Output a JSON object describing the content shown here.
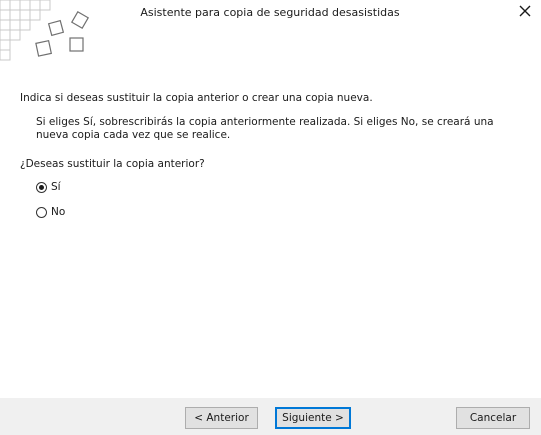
{
  "window": {
    "title": "Asistente para copia de seguridad desasistidas",
    "close_icon": "close-icon"
  },
  "main": {
    "question": "Indica si deseas sustituir la copia anterior o crear una copia nueva.",
    "explanation": "Si eliges Sí, sobrescribirás la copia anteriormente realizada. Si eliges No, se creará una nueva copia cada vez que se realice.",
    "prompt": "¿Deseas sustituir la copia anterior?",
    "options": [
      {
        "label": "Sí",
        "selected": true
      },
      {
        "label": "No",
        "selected": false
      }
    ]
  },
  "footer": {
    "back_label": "< Anterior",
    "next_label": "Siguiente >",
    "cancel_label": "Cancelar"
  },
  "colors": {
    "footer_bg": "#f0f0f0",
    "focus_border": "#0078d7"
  }
}
